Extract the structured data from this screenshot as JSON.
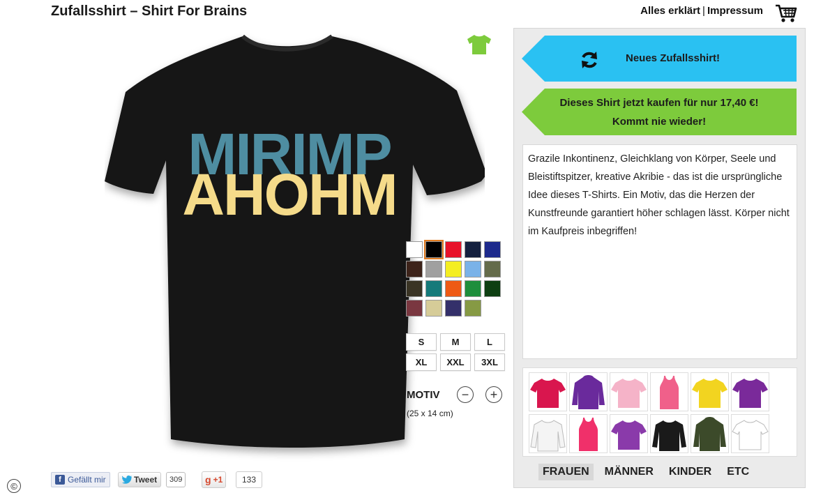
{
  "header": {
    "site_title": "Zufallsshirt – Shirt For Brains",
    "nav_explained": "Alles erklärt",
    "nav_separator": "|",
    "nav_imprint": "Impressum",
    "cart_icon": "shopping-cart-icon"
  },
  "design": {
    "line1": "MIRIMP",
    "line2": "AHOHM",
    "color_teal": "#4e8da1",
    "color_yellow": "#f5db8a",
    "shirt_color": "#121212"
  },
  "swatches": [
    {
      "color": "#ffffff",
      "selected": false
    },
    {
      "color": "#000000",
      "selected": true
    },
    {
      "color": "#e8122a",
      "selected": false
    },
    {
      "color": "#14203f",
      "selected": false
    },
    {
      "color": "#1d2a8c",
      "selected": false
    },
    {
      "color": "#3d231a",
      "selected": false
    },
    {
      "color": "#a0a0a0",
      "selected": false
    },
    {
      "color": "#f4ee22",
      "selected": false
    },
    {
      "color": "#7ab2e8",
      "selected": false
    },
    {
      "color": "#646b4a",
      "selected": false
    },
    {
      "color": "#3a3424",
      "selected": false
    },
    {
      "color": "#157a7a",
      "selected": false
    },
    {
      "color": "#ee5a14",
      "selected": false
    },
    {
      "color": "#1e8e3c",
      "selected": false
    },
    {
      "color": "#0e3f12",
      "selected": false
    },
    {
      "color": "#7a3740",
      "selected": false
    },
    {
      "color": "#d6cc98",
      "selected": false
    },
    {
      "color": "#34306a",
      "selected": false
    },
    {
      "color": "#869a44",
      "selected": false
    }
  ],
  "sizes": [
    "S",
    "M",
    "L",
    "XL",
    "XXL",
    "3XL"
  ],
  "motiv": {
    "label": "MOTIV",
    "minus": "−",
    "plus": "+",
    "dimensions": "(25 x 14 cm)"
  },
  "social": {
    "like_label": "Gefällt mir",
    "fb_letter": "f",
    "tweet_label": "Tweet",
    "tweet_count": "309",
    "gplus_label": "+1",
    "gplus_count": "133",
    "copyright_symbol": "©"
  },
  "panel": {
    "random_label": "Neues Zufallsshirt!",
    "buy_line1": "Dieses Shirt jetzt kaufen für nur 17,40 €!",
    "buy_line2": "Kommt nie wieder!",
    "description": "Grazile Inkontinenz, Gleichklang von Körper, Seele und Bleistiftspitzer, kreative Akribie - das ist die ursprüngliche Idee dieses T-Shirts. Ein Motiv, das die Herzen der Kunstfreunde garantiert höher schlagen lässt. Körper nicht im Kaufpreis inbegriffen!",
    "accent_blue": "#2ac1f2",
    "accent_green": "#7dcb3c"
  },
  "products": [
    {
      "type": "tee",
      "color": "#d9164e"
    },
    {
      "type": "hoodie",
      "color": "#6a2a9c"
    },
    {
      "type": "tee",
      "color": "#f5b3c8"
    },
    {
      "type": "tank",
      "color": "#f0608a"
    },
    {
      "type": "tee",
      "color": "#f2d420"
    },
    {
      "type": "tee",
      "color": "#7a2a9a"
    },
    {
      "type": "longsleeve",
      "color": "#f4f4f4"
    },
    {
      "type": "tank",
      "color": "#f0306a"
    },
    {
      "type": "tee",
      "color": "#8a3aaa"
    },
    {
      "type": "longsleeve",
      "color": "#1a1a1a"
    },
    {
      "type": "hoodie",
      "color": "#3c4a2a"
    },
    {
      "type": "tee",
      "color": "#ffffff"
    }
  ],
  "categories": [
    {
      "label": "FRAUEN",
      "active": true
    },
    {
      "label": "MÄNNER",
      "active": false
    },
    {
      "label": "KINDER",
      "active": false
    },
    {
      "label": "ETC",
      "active": false
    }
  ]
}
